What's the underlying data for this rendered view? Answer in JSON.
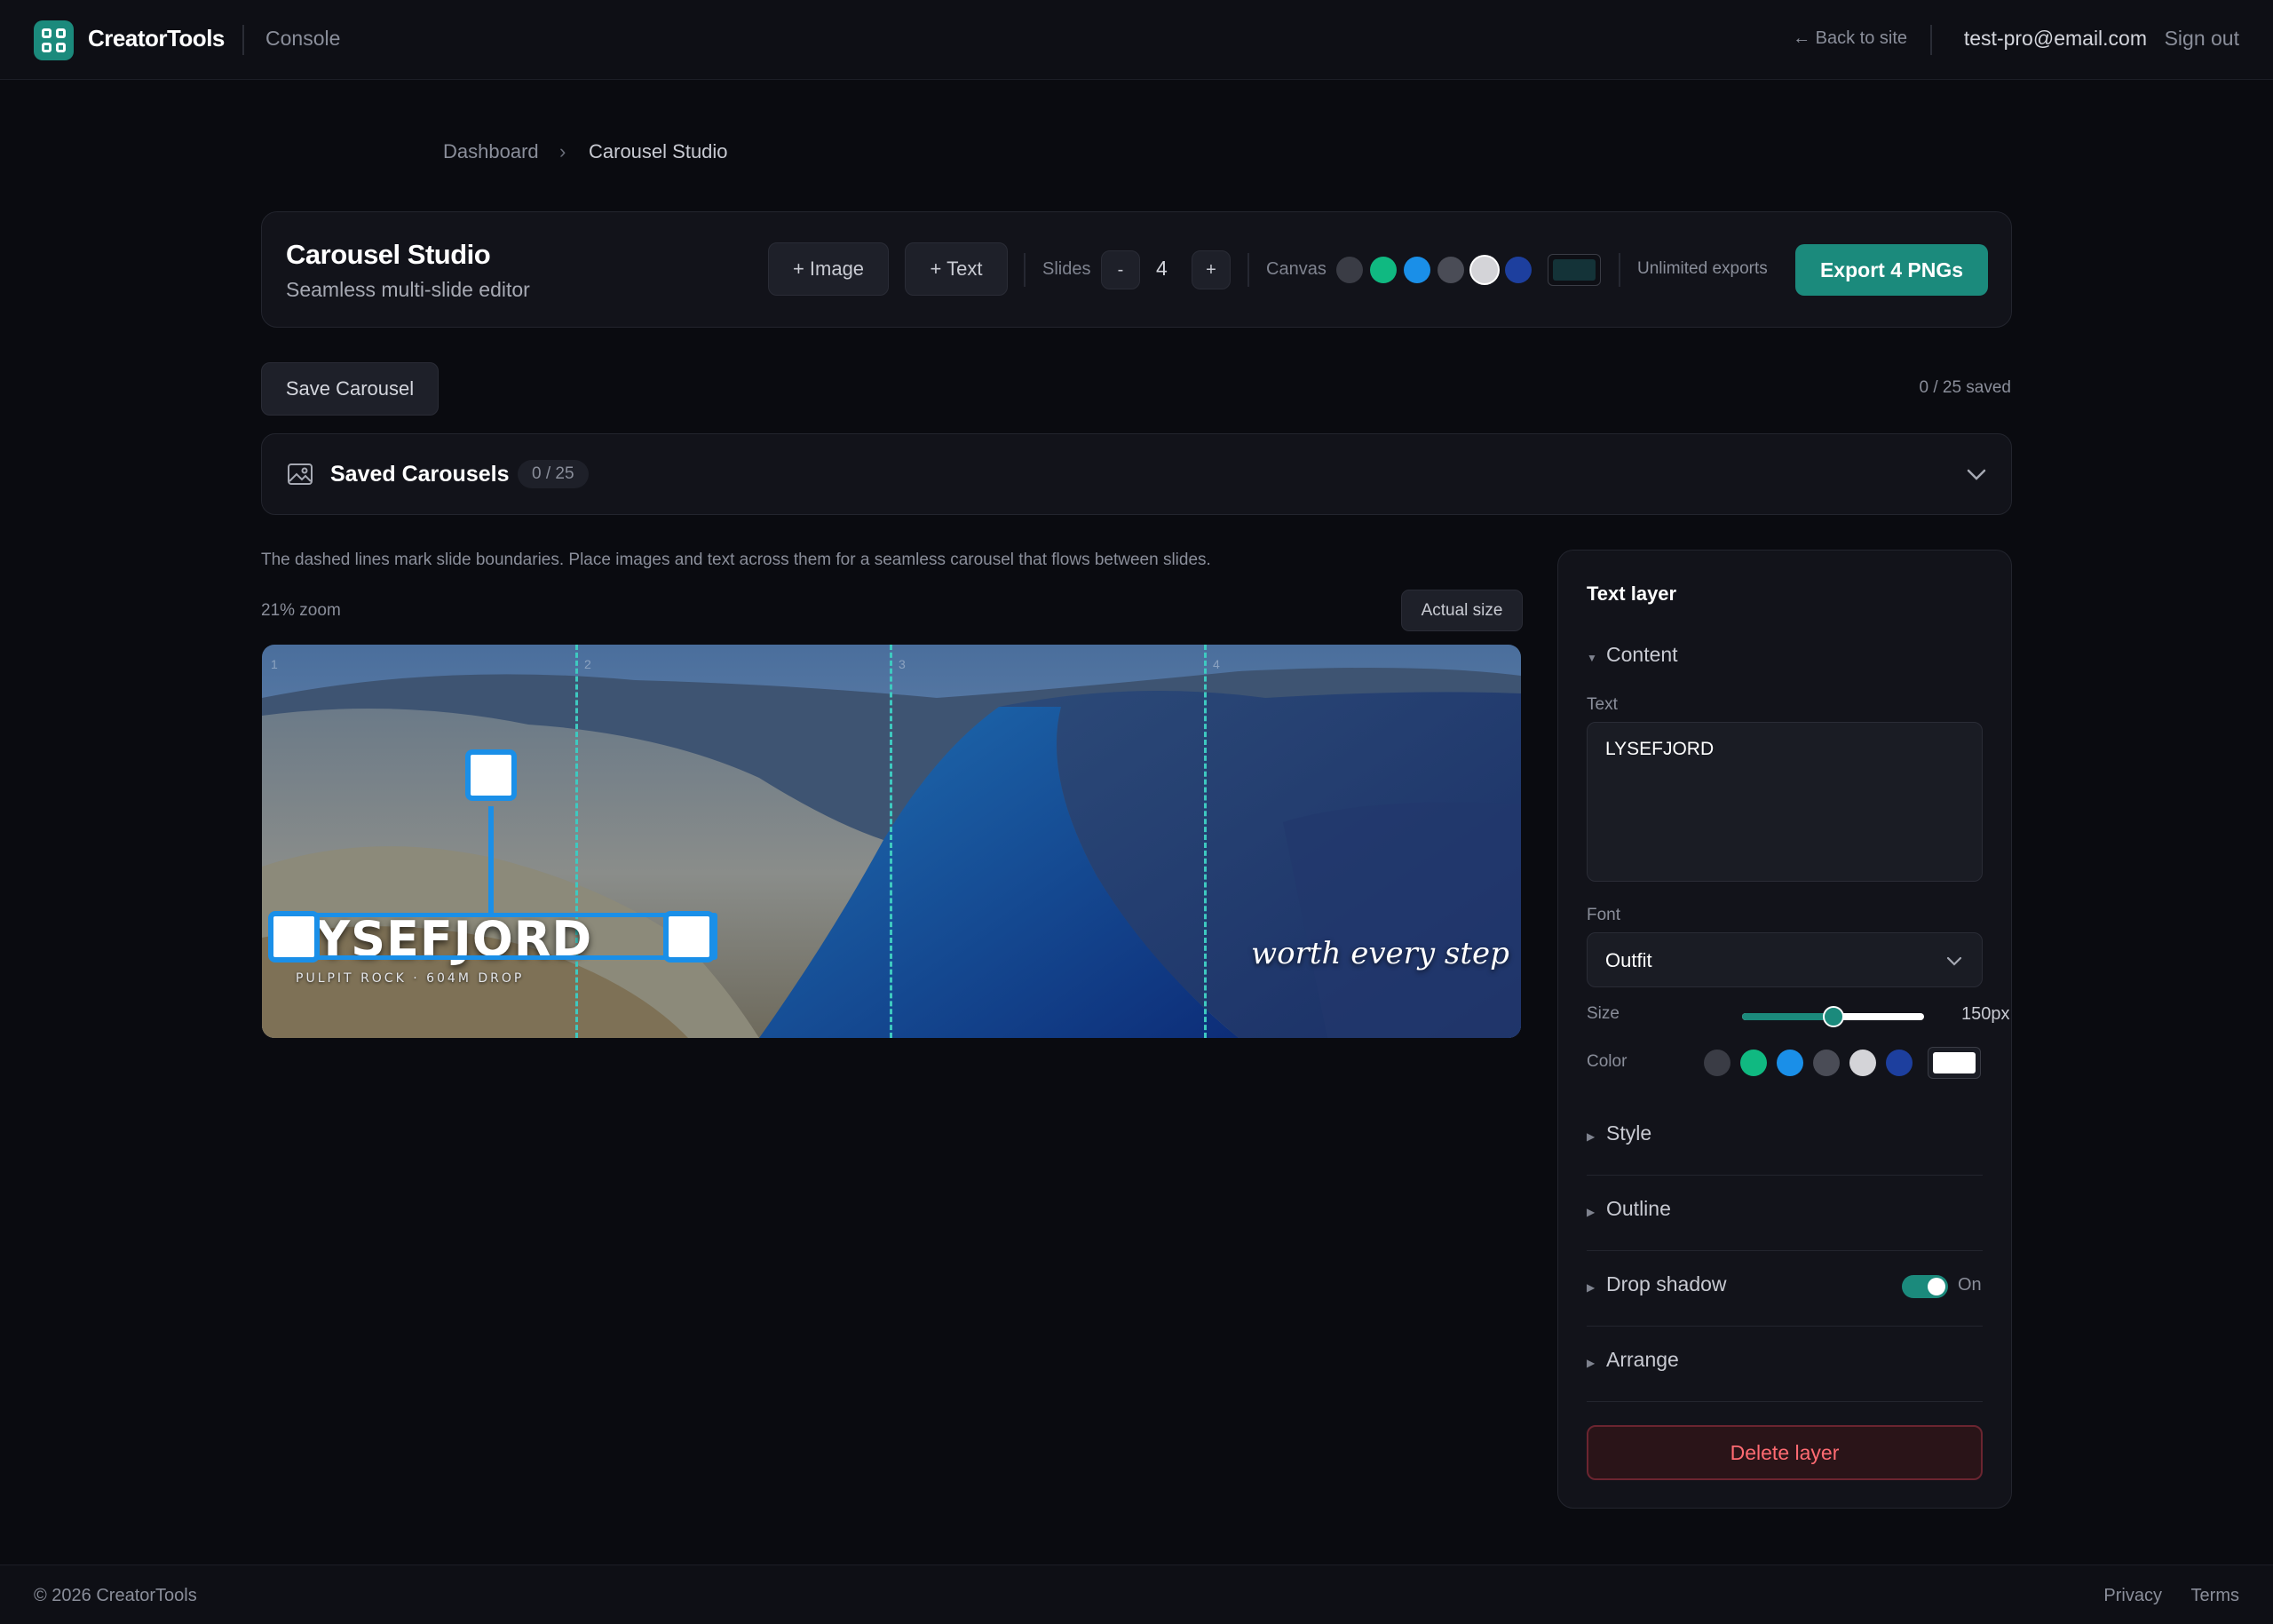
{
  "header": {
    "brand": "CreatorTools",
    "section": "Console",
    "back_link": "← Back to site",
    "user_email": "test-pro@email.com",
    "sign_out": "Sign out"
  },
  "breadcrumb": {
    "items": [
      "Dashboard",
      "Carousel Studio"
    ],
    "separator": "›"
  },
  "toolbar": {
    "title": "Carousel Studio",
    "subtitle": "Seamless multi-slide editor",
    "add_image": "+ Image",
    "add_text": "+ Text",
    "slides_label": "Slides",
    "slides_minus": "-",
    "slides_count": "4",
    "slides_plus": "+",
    "canvas_label": "Canvas",
    "canvas_colors": [
      "#3a3c45",
      "#10b981",
      "#1a8fe8",
      "#4a4c56",
      "#d4d4d8",
      "#1d3f9e"
    ],
    "canvas_custom_color": "#143338",
    "exports_note": "Unlimited exports",
    "export_button": "Export 4 PNGs"
  },
  "save": {
    "button": "Save Carousel",
    "count": "0 / 25 saved"
  },
  "saved_panel": {
    "title": "Saved Carousels",
    "badge": "0 / 25"
  },
  "editor": {
    "hint": "The dashed lines mark slide boundaries. Place images and text across them for a seamless carousel that flows between slides.",
    "zoom": "21% zoom",
    "actual_size": "Actual size",
    "slide_numbers": [
      "1",
      "2",
      "3",
      "4"
    ],
    "canvas_title": "YSEFJORD",
    "canvas_subtitle": "PULPIT ROCK · 604M DROP",
    "canvas_script": "worth every step"
  },
  "layer_panel": {
    "title": "Text layer",
    "sections": {
      "content": "Content",
      "style": "Style",
      "outline": "Outline",
      "drop_shadow": "Drop shadow",
      "arrange": "Arrange"
    },
    "text_label": "Text",
    "text_value": "LYSEFJORD",
    "font_label": "Font",
    "font_value": "Outfit",
    "size_label": "Size",
    "size_value": "150px",
    "size_level": 0.5,
    "color_label": "Color",
    "color_swatches": [
      "#3a3c45",
      "#10b981",
      "#1a8fe8",
      "#4a4c56",
      "#d4d4d8",
      "#1d3f9e"
    ],
    "color_custom": "#ffffff",
    "drop_shadow_state": "On",
    "delete_button": "Delete layer"
  },
  "footer": {
    "copyright": "© 2026 CreatorTools",
    "privacy": "Privacy",
    "terms": "Terms"
  }
}
